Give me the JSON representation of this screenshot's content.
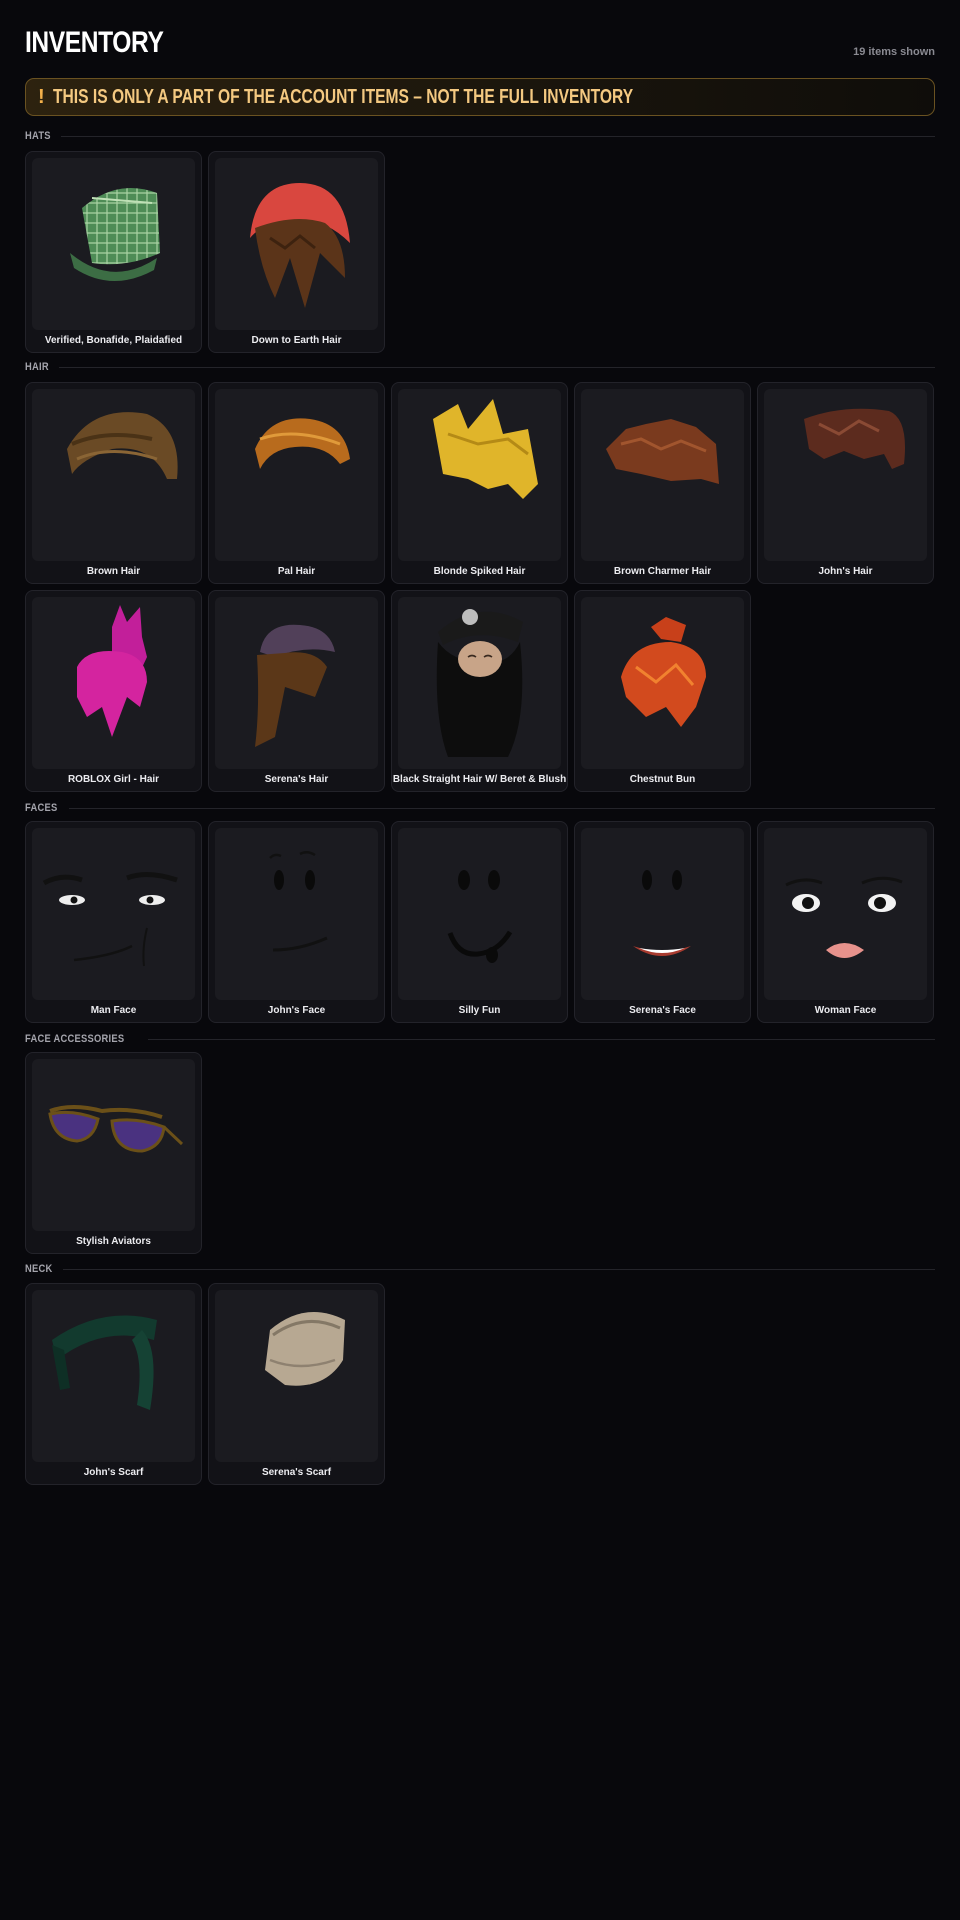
{
  "header": {
    "title": "INVENTORY",
    "count_text": "19 items shown"
  },
  "warning": {
    "icon": "!",
    "message": "THIS IS ONLY A PART OF THE ACCOUNT ITEMS – NOT THE FULL INVENTORY"
  },
  "sections": {
    "hats": {
      "label": "HATS",
      "items": [
        {
          "name": "Verified, Bonafide, Plaidafied",
          "icon": "plaid-cap-icon"
        },
        {
          "name": "Down to Earth Hair",
          "icon": "red-beanie-hair-icon"
        }
      ]
    },
    "hair": {
      "label": "HAIR",
      "items": [
        {
          "name": "Brown Hair",
          "icon": "brown-hair-icon"
        },
        {
          "name": "Pal Hair",
          "icon": "pal-hair-icon"
        },
        {
          "name": "Blonde Spiked Hair",
          "icon": "blonde-spiked-hair-icon"
        },
        {
          "name": "Brown Charmer Hair",
          "icon": "brown-charmer-hair-icon"
        },
        {
          "name": "John's Hair",
          "icon": "johns-hair-icon"
        },
        {
          "name": "ROBLOX Girl - Hair",
          "icon": "pink-girl-hair-icon"
        },
        {
          "name": "Serena's Hair",
          "icon": "serenas-hair-icon"
        },
        {
          "name": "Black Straight Hair W/ Beret & Blush",
          "icon": "black-beret-hair-icon"
        },
        {
          "name": "Chestnut Bun",
          "icon": "chestnut-bun-icon"
        }
      ]
    },
    "faces": {
      "label": "FACES",
      "items": [
        {
          "name": "Man Face",
          "icon": "man-face-icon"
        },
        {
          "name": "John's Face",
          "icon": "johns-face-icon"
        },
        {
          "name": "Silly Fun",
          "icon": "silly-fun-face-icon"
        },
        {
          "name": "Serena's Face",
          "icon": "serenas-face-icon"
        },
        {
          "name": "Woman Face",
          "icon": "woman-face-icon"
        }
      ]
    },
    "face_accessories": {
      "label": "FACE ACCESSORIES",
      "items": [
        {
          "name": "Stylish Aviators",
          "icon": "aviator-sunglasses-icon"
        }
      ]
    },
    "neck": {
      "label": "NECK",
      "items": [
        {
          "name": "John's Scarf",
          "icon": "green-scarf-icon"
        },
        {
          "name": "Serena's Scarf",
          "icon": "beige-scarf-icon"
        }
      ]
    }
  },
  "colors": {
    "background": "#08080c",
    "card": "#121217",
    "thumb": "#1b1b20",
    "warning_text": "#f4c981",
    "warning_border": "#6a5221"
  }
}
